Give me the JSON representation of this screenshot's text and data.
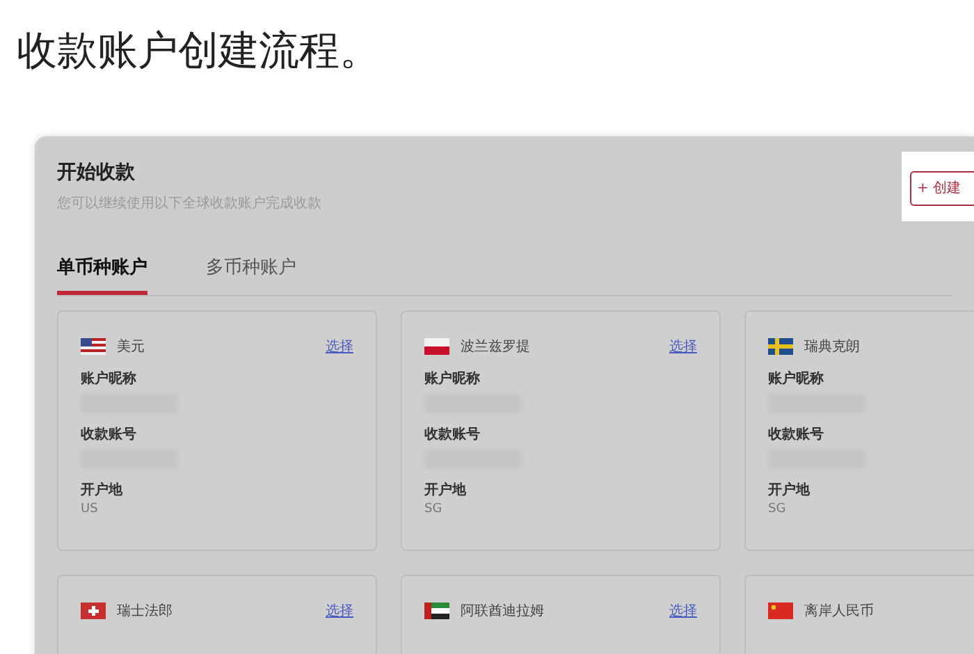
{
  "heading": "收款账户创建流程。",
  "panel": {
    "title": "开始收款",
    "subtitle": "您可以继续使用以下全球收款账户完成收款",
    "create_button": "+ 创建",
    "tabs": [
      {
        "label": "单币种账户",
        "selected": true
      },
      {
        "label": "多币种账户",
        "selected": false
      }
    ],
    "cards": [
      {
        "kind": "us",
        "currency": "美元",
        "select_link": "选择",
        "fields": [
          {
            "label": "账户昵称",
            "kind": "masked"
          },
          {
            "label": "收款账号",
            "kind": "masked"
          },
          {
            "label": "开户地",
            "kind": "text",
            "value": "US"
          }
        ]
      },
      {
        "kind": "pl",
        "currency": "波兰兹罗提",
        "select_link": "选择",
        "fields": [
          {
            "label": "账户昵称",
            "kind": "masked"
          },
          {
            "label": "收款账号",
            "kind": "masked"
          },
          {
            "label": "开户地",
            "kind": "text",
            "value": "SG"
          }
        ]
      },
      {
        "kind": "se",
        "currency": "瑞典克朗",
        "fields": [
          {
            "label": "账户昵称",
            "kind": "masked"
          },
          {
            "label": "收款账号",
            "kind": "masked"
          },
          {
            "label": "开户地",
            "kind": "text",
            "value": "SG"
          }
        ]
      },
      {
        "kind": "ch",
        "currency": "瑞士法郎",
        "select_link": "选择"
      },
      {
        "kind": "ae",
        "currency": "阿联酋迪拉姆",
        "select_link": "选择"
      },
      {
        "kind": "cn",
        "currency": "离岸人民币"
      }
    ]
  }
}
